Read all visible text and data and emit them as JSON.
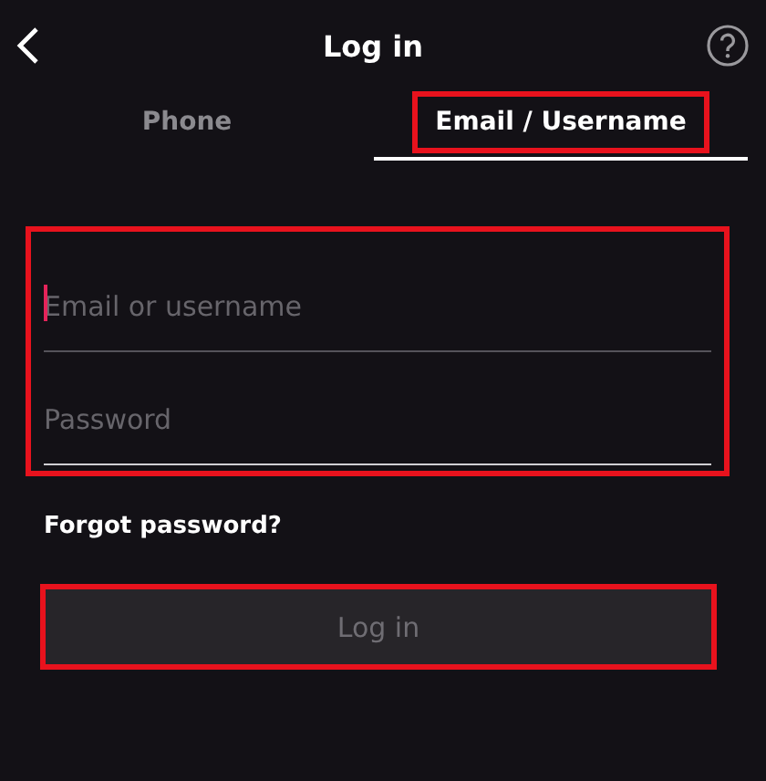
{
  "header": {
    "title": "Log in"
  },
  "tabs": [
    {
      "label": "Phone",
      "selected": false,
      "highlighted": false
    },
    {
      "label": "Email / Username",
      "selected": true,
      "highlighted": true
    }
  ],
  "form": {
    "highlighted": true,
    "fields": [
      {
        "placeholder": "Email or username",
        "focused": true
      },
      {
        "placeholder": "Password",
        "focused": false
      }
    ]
  },
  "forgot_link": "Forgot password?",
  "login_button": {
    "label": "Log in",
    "disabled": true,
    "highlighted": true
  }
}
